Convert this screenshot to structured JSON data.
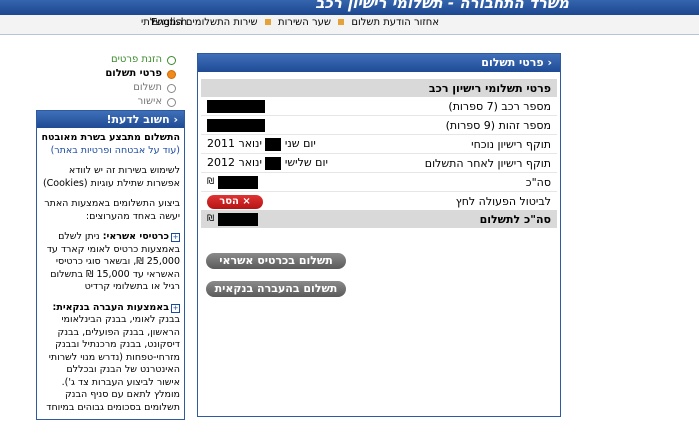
{
  "header": {
    "title": "משרד התחבורה - תשלומי רישיון רכב",
    "ministry": "משרד התחבורה"
  },
  "nav": {
    "links": [
      "אחזור הודעת תשלום",
      "שער השירות",
      "שירות התשלומים הממשלתי"
    ],
    "language": "English"
  },
  "steps": [
    {
      "label": "הזנת פרטים",
      "state": "done"
    },
    {
      "label": "פרטי תשלום",
      "state": "current"
    },
    {
      "label": "תשלום",
      "state": "todo"
    },
    {
      "label": "אישור",
      "state": "todo"
    }
  ],
  "important": {
    "title": "‹ חשוב לדעת!",
    "secure_title": "התשלום מתבצע בשרת מאובטח",
    "secure_link": "(עוד על אבטחה ופרטיות באתר)",
    "cookies_text": "לשימוש בשירות זה יש לוודא אפשרות שתילת עוגיות (Cookies)",
    "methods_intro": "ביצוע התשלומים באמצעות האתר יעשה באחד מהערוצים:",
    "credit_title": "כרטיסי אשראי:",
    "credit_text": "ניתן לשלם באמצעות כרטיס לאומי קארד עד 25,000 ₪, ובשאר סוגי כרטיסי האשראי עד 15,000 ₪ בתשלום רגיל או בתשלומי קרדיט",
    "bank_title": "באמצעות העברה בנקאית:",
    "bank_text": "בבנק לאומי, בבנק הבינלאומי הראשון, בבנק הפועלים, בבנק דיסקונט, בבנק מרכנתיל ובבנק מזרחי-טפחות (נדרש מנוי לשרותי האינטרנט של הבנק ובכללם אישור לביצוע העברות צד ג'). מומלץ לתאם עם סניף הבנק תשלומים בסכומים גבוהים במיוחד"
  },
  "main": {
    "title": "‹ פרטי תשלום",
    "section_title": "פרטי תשלומי רישיון רכב",
    "rows": [
      {
        "label": "מספר רכב (7 ספרות)",
        "value": ""
      },
      {
        "label": "מספר זהות (9 ספרות)",
        "value": ""
      },
      {
        "label": "תוקף רישיון נוכחי",
        "value_prefix": "יום שני",
        "value_suffix": "ינואר 2011"
      },
      {
        "label": "תוקף רישיון לאחר התשלום",
        "value_prefix": "יום שלישי",
        "value_suffix": "ינואר 2012"
      },
      {
        "label": "סה\"כ",
        "currency": "₪"
      },
      {
        "label": "לביטול הפעולה לחץ",
        "button": "× הסר"
      }
    ],
    "total_label": "סה\"כ לתשלום",
    "total_currency": "₪",
    "pay_credit": "תשלום בכרטיס אשראי",
    "pay_bank": "תשלום בהעברה בנקאית"
  }
}
